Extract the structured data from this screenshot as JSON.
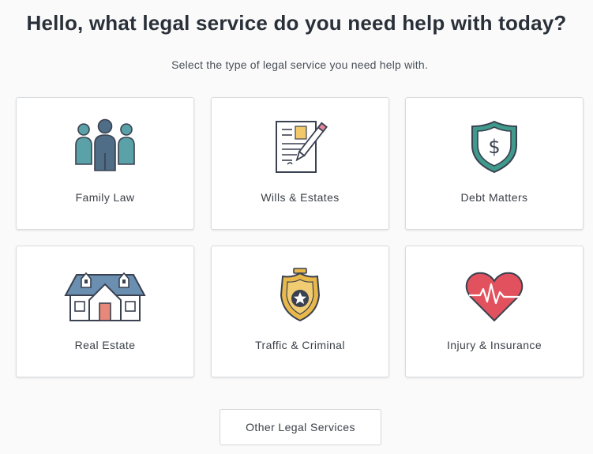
{
  "header": {
    "title": "Hello, what legal service do you need help with today?",
    "subtitle": "Select the type of legal service you need help with."
  },
  "services": [
    {
      "label": "Family Law",
      "icon": "family-icon"
    },
    {
      "label": "Wills & Estates",
      "icon": "document-pen-icon"
    },
    {
      "label": "Debt Matters",
      "icon": "dollar-shield-icon"
    },
    {
      "label": "Real Estate",
      "icon": "house-icon"
    },
    {
      "label": "Traffic & Criminal",
      "icon": "police-badge-icon"
    },
    {
      "label": "Injury & Insurance",
      "icon": "heart-pulse-icon"
    }
  ],
  "other_button": {
    "label": "Other Legal Services"
  },
  "colors": {
    "family_blue": "#4f6d87",
    "family_teal": "#5aa1a8",
    "shield_teal": "#3f9a8c",
    "house_blue": "#6a8fb0",
    "house_door": "#e7887b",
    "badge_gold": "#e8b84a",
    "heart_red": "#e2525e"
  }
}
